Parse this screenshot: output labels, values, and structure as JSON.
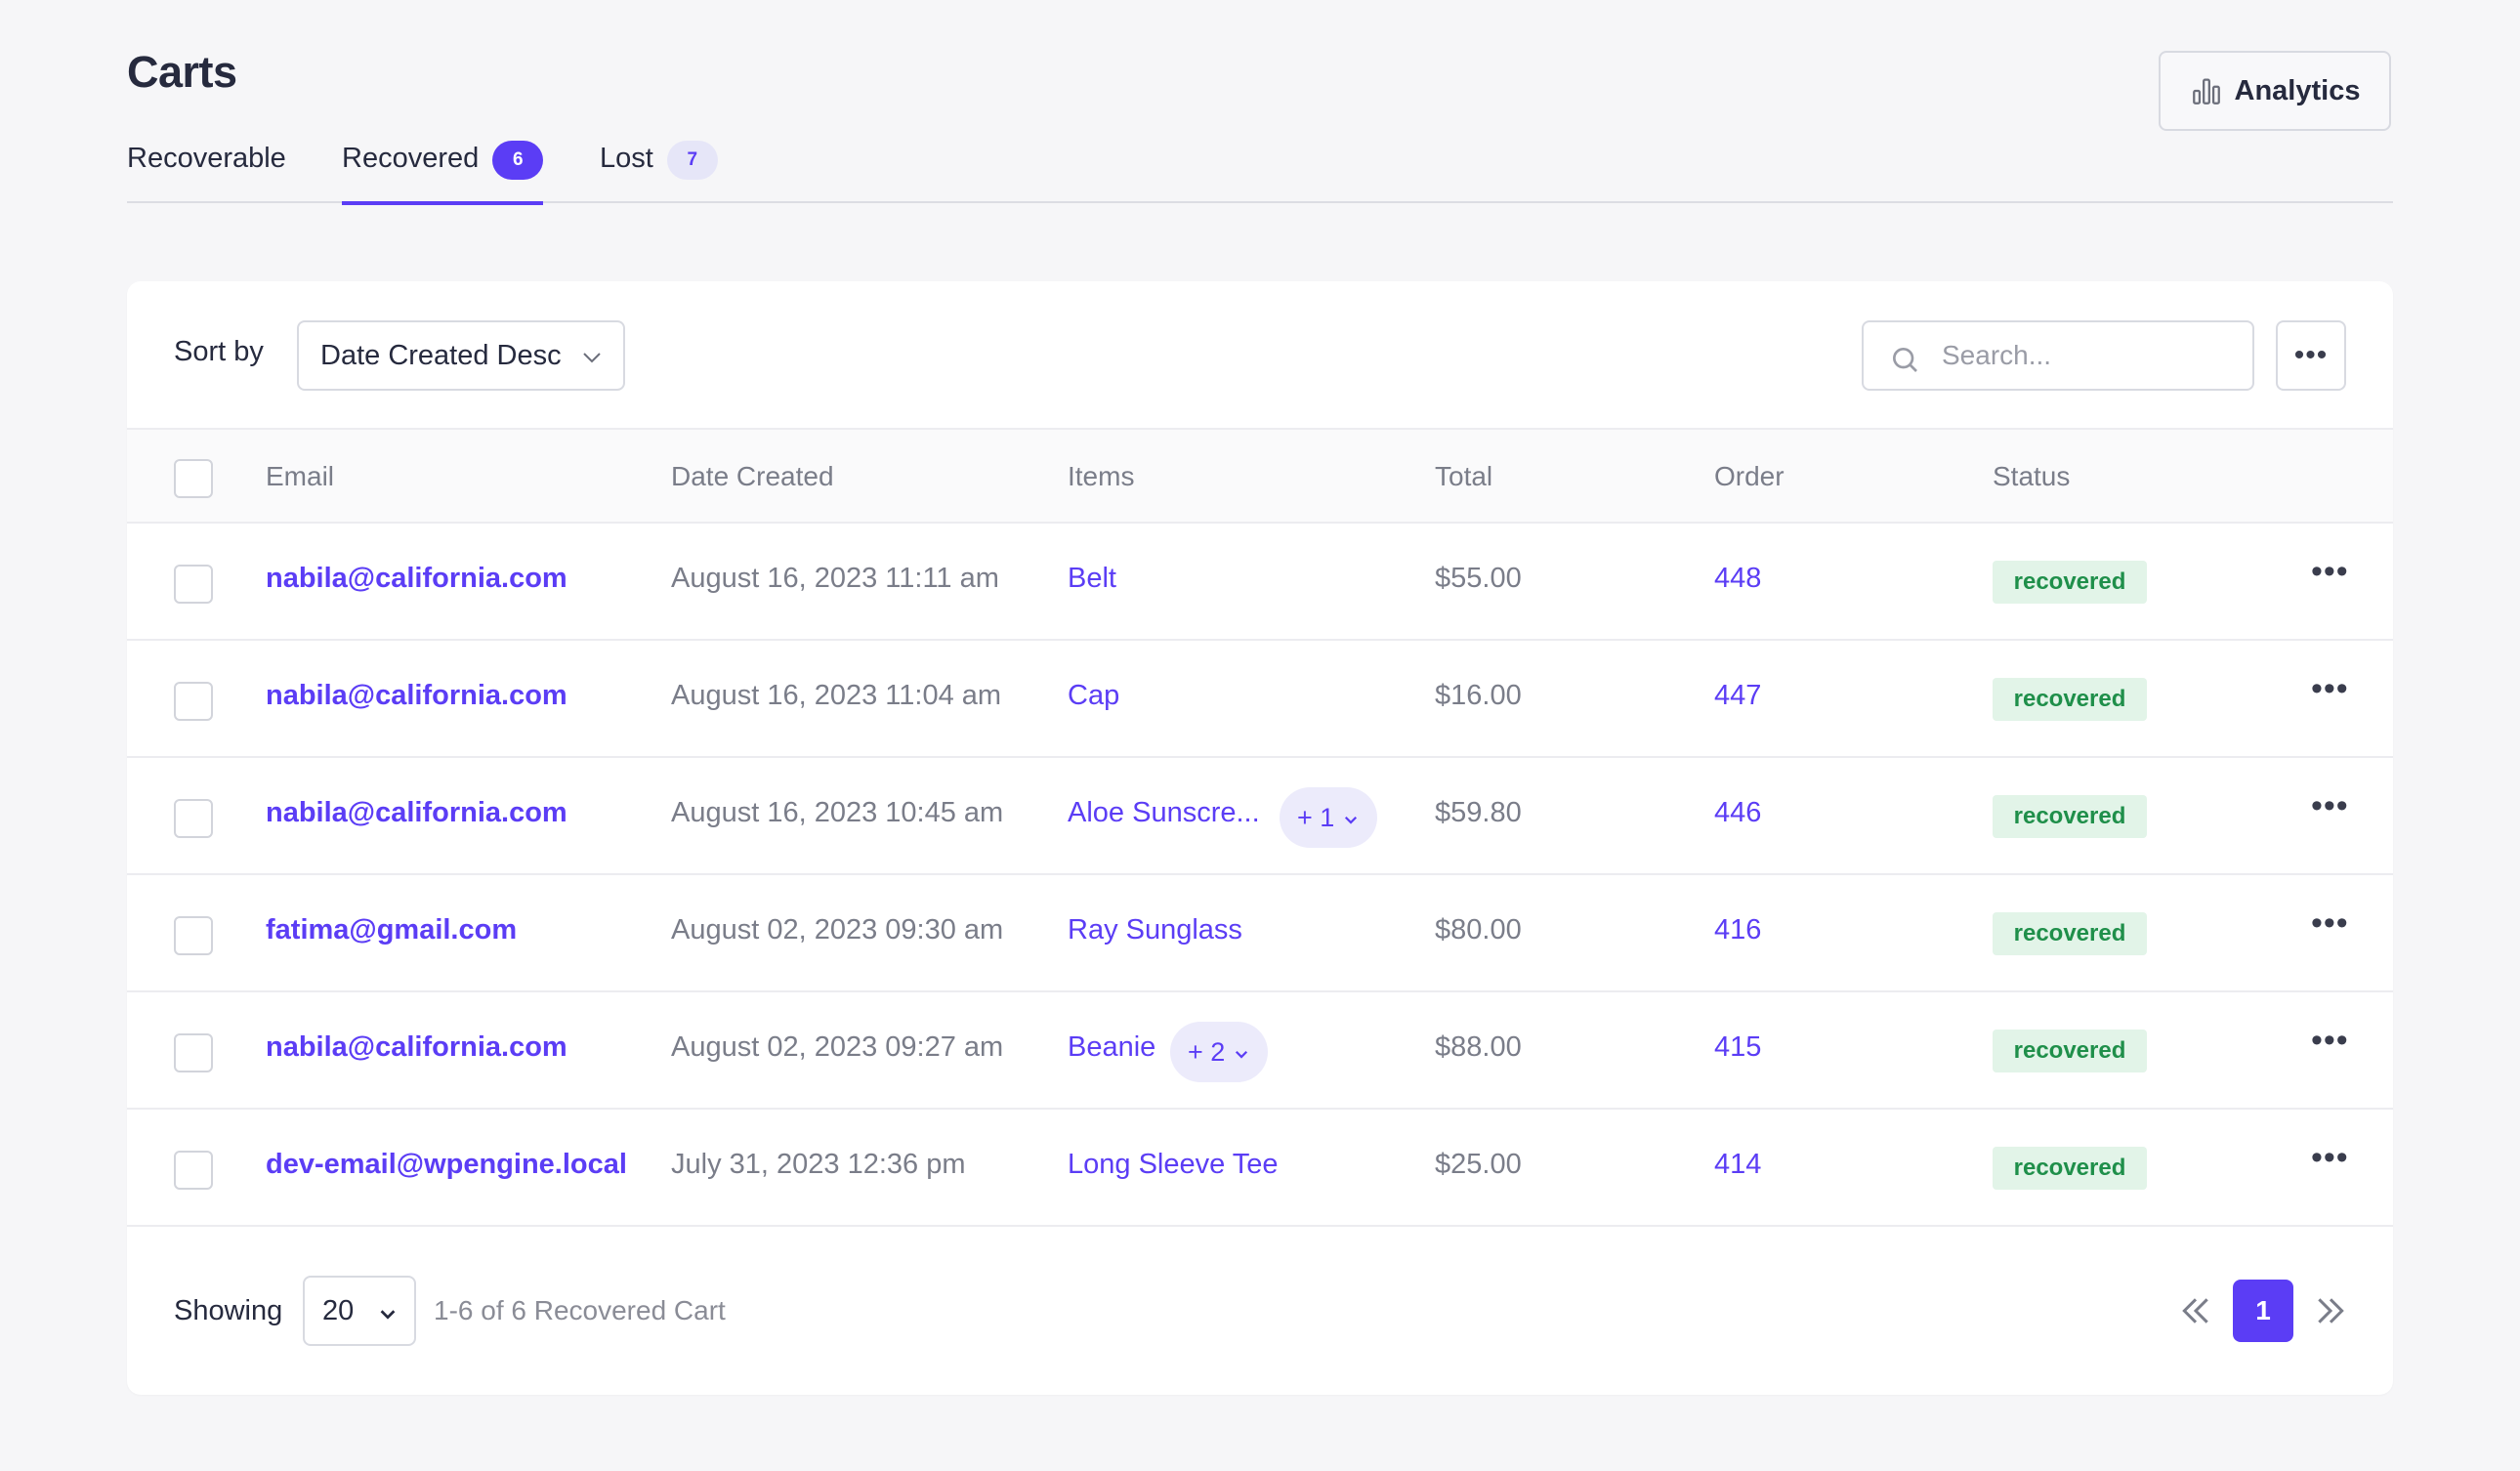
{
  "header": {
    "title": "Carts",
    "analytics_label": "Analytics"
  },
  "tabs": [
    {
      "label": "Recoverable",
      "count": ""
    },
    {
      "label": "Recovered",
      "count": "6"
    },
    {
      "label": "Lost",
      "count": "7"
    }
  ],
  "toolbar": {
    "sort_label": "Sort by",
    "sort_value": "Date Created Desc",
    "search_placeholder": "Search...",
    "more_label": "•••"
  },
  "table": {
    "columns": {
      "email": "Email",
      "date": "Date Created",
      "items": "Items",
      "total": "Total",
      "order": "Order",
      "status": "Status"
    },
    "rows": [
      {
        "email": "nabila@california.com",
        "date": "August 16, 2023 11:11 am",
        "item": "Belt",
        "extra": "",
        "total": "$55.00",
        "order": "448",
        "status": "recovered"
      },
      {
        "email": "nabila@california.com",
        "date": "August 16, 2023 11:04 am",
        "item": "Cap",
        "extra": "",
        "total": "$16.00",
        "order": "447",
        "status": "recovered"
      },
      {
        "email": "nabila@california.com",
        "date": "August 16, 2023 10:45 am",
        "item": "Aloe Sunscre...",
        "extra": "+ 1",
        "total": "$59.80",
        "order": "446",
        "status": "recovered"
      },
      {
        "email": "fatima@gmail.com",
        "date": "August 02, 2023 09:30 am",
        "item": "Ray Sunglass",
        "extra": "",
        "total": "$80.00",
        "order": "416",
        "status": "recovered"
      },
      {
        "email": "nabila@california.com",
        "date": "August 02, 2023 09:27 am",
        "item": "Beanie",
        "extra": "+ 2",
        "total": "$88.00",
        "order": "415",
        "status": "recovered"
      },
      {
        "email": "dev-email@wpengine.local",
        "date": "July 31, 2023 12:36 pm",
        "item": "Long Sleeve Tee",
        "extra": "",
        "total": "$25.00",
        "order": "414",
        "status": "recovered"
      }
    ],
    "row_more_label": "•••"
  },
  "footer": {
    "showing_label": "Showing",
    "page_size": "20",
    "range_text": "1-6 of 6 Recovered Cart",
    "current_page": "1"
  },
  "colors": {
    "accent": "#5b3df5",
    "status_bg": "#e2f4e8",
    "status_text": "#1f8f4a"
  }
}
